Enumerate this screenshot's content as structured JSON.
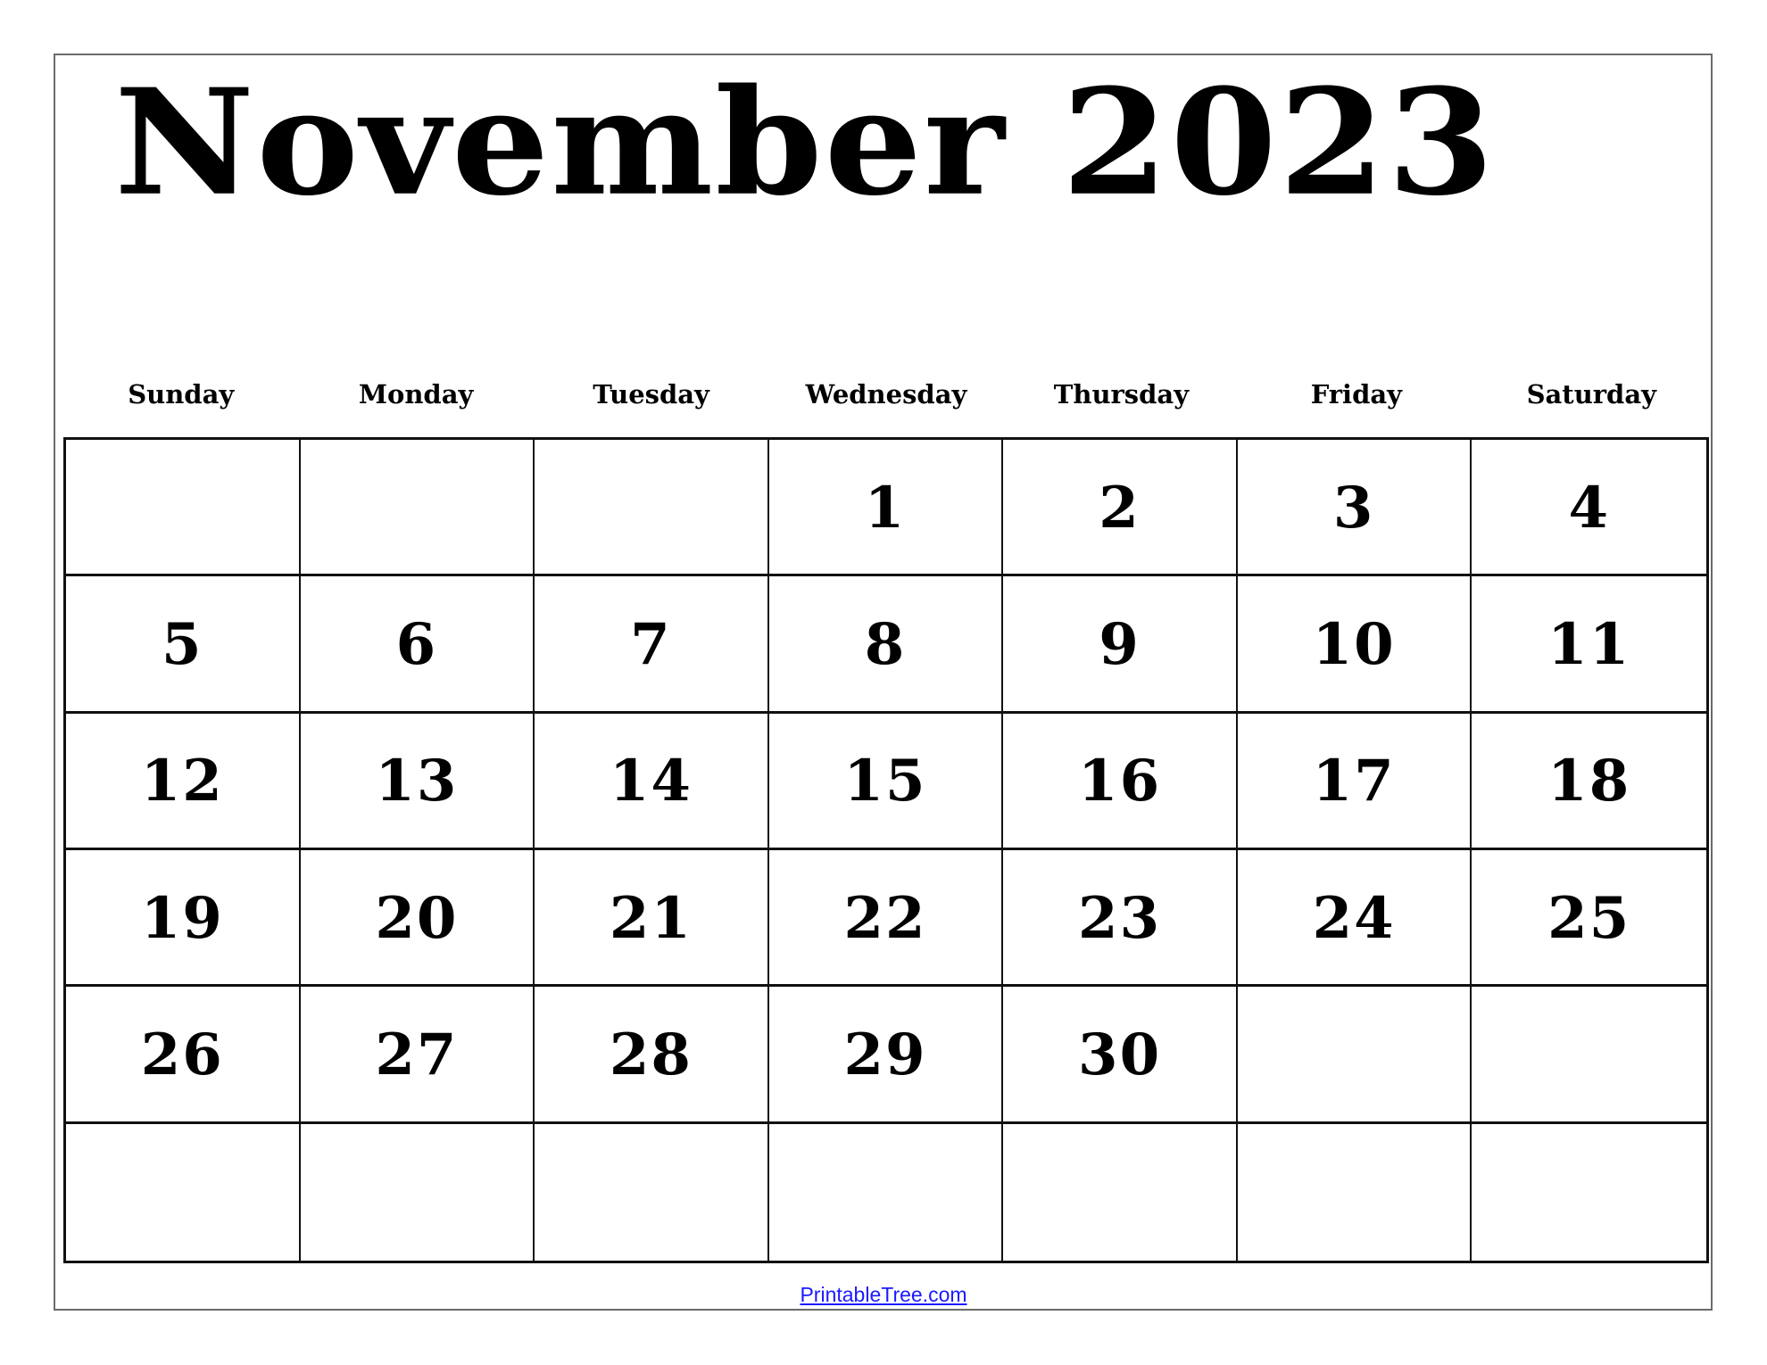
{
  "calendar": {
    "title": "November 2023",
    "month": "November",
    "year": 2023,
    "weekdays": [
      "Sunday",
      "Monday",
      "Tuesday",
      "Wednesday",
      "Thursday",
      "Friday",
      "Saturday"
    ],
    "weeks": [
      [
        "",
        "",
        "",
        "1",
        "2",
        "3",
        "4"
      ],
      [
        "5",
        "6",
        "7",
        "8",
        "9",
        "10",
        "11"
      ],
      [
        "12",
        "13",
        "14",
        "15",
        "16",
        "17",
        "18"
      ],
      [
        "19",
        "20",
        "21",
        "22",
        "23",
        "24",
        "25"
      ],
      [
        "26",
        "27",
        "28",
        "29",
        "30",
        "",
        ""
      ],
      [
        "",
        "",
        "",
        "",
        "",
        "",
        ""
      ]
    ]
  },
  "footer": {
    "link_text": "PrintableTree.com",
    "link_color": "#1a1aff"
  }
}
